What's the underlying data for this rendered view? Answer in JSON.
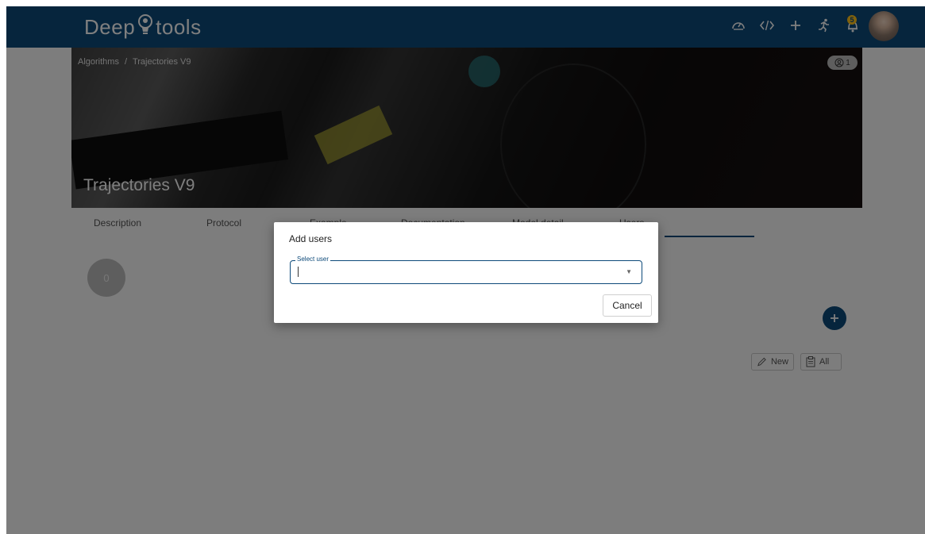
{
  "app": {
    "logo_left": "Deep",
    "logo_right": "tools"
  },
  "header_icons": [
    "speedometer-icon",
    "code-icon",
    "plus-icon",
    "run-icon",
    "notification-icon"
  ],
  "notifications": {
    "count": "5"
  },
  "breadcrumb": {
    "root": "Algorithms",
    "separator": "/",
    "current": "Trajectories V9"
  },
  "watchers": {
    "count": "1"
  },
  "hero": {
    "title": "Trajectories V9"
  },
  "tabs": [
    {
      "label": "Description"
    },
    {
      "label": "Protocol"
    },
    {
      "label": "Example"
    },
    {
      "label": "Documentation"
    },
    {
      "label": "Model detail"
    },
    {
      "label": "Users"
    }
  ],
  "active_tab": "Users",
  "users_count": "0",
  "actions": {
    "new_label": "New",
    "all_label": "All"
  },
  "dialog": {
    "title": "Add users",
    "select_label": "Select user",
    "select_value": "",
    "cancel_label": "Cancel"
  },
  "colors": {
    "primary": "#0d4a7a",
    "badge": "#ffc21a"
  }
}
